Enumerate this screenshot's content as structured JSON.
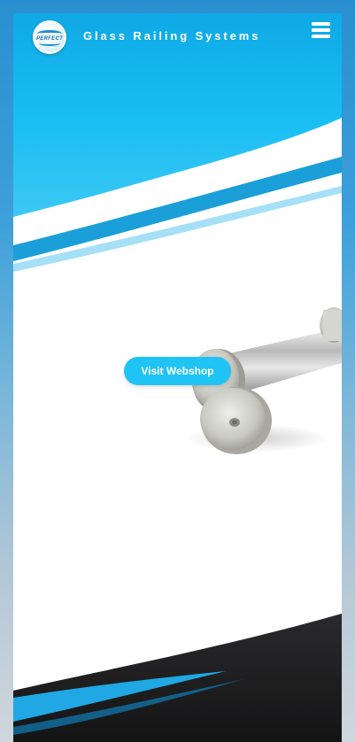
{
  "header": {
    "logo_text": "PERFECT",
    "site_title": "Glass Railing Systems",
    "menu_icon": "hamburger-menu-icon"
  },
  "hero": {
    "cta_label": "Visit Webshop"
  },
  "colors": {
    "brand_blue": "#1fc3f4",
    "sky_blue": "#12b7ee",
    "dark_footer": "#1c1c1e",
    "page_bg": "#2a8fd0"
  }
}
